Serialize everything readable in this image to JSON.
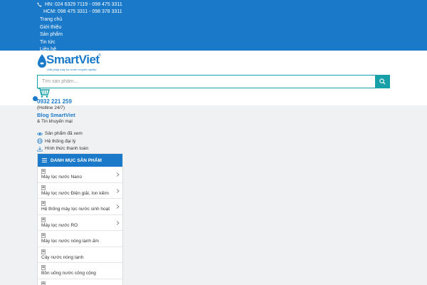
{
  "topbar": {
    "hn_label": "HN: 024 6329 7119 - 098 475 3311",
    "hcm_label": "HCM: 098 475 3311 - 098 378 3311",
    "nav": [
      "Trang chủ",
      "Giới thiệu",
      "Sản phẩm",
      "Tin tức",
      "Liên hệ"
    ],
    "bg_color": "#1a7ac9"
  },
  "header": {
    "logo_text": "SmartViet",
    "logo_tagline": "Giải pháp máy lọc nước chuyên nghiệp",
    "search_placeholder": "Tìm sản phẩm...",
    "hotline_number": "0932 221 259",
    "hotline_note": "(Hotline 24/7)",
    "blog_label": "Blog SmartViet",
    "blog_sub": "& Tin khuyến mại",
    "accent_color": "#17a0a8"
  },
  "quick_links": [
    {
      "icon": "eye-icon",
      "label": "Sản phẩm đã xem"
    },
    {
      "icon": "globe-icon",
      "label": "Hệ thống đại lý"
    },
    {
      "icon": "download-icon",
      "label": "Hình thức thanh toán"
    }
  ],
  "category": {
    "title": "DANH MỤC SẢN PHẨM",
    "items": [
      {
        "label": "Máy lọc nước Nano",
        "has_sub": true
      },
      {
        "label": "Máy lọc nước Điện giải, Ion kiềm",
        "has_sub": true
      },
      {
        "label": "Hệ thống máy lọc nước sinh hoạt",
        "has_sub": true
      },
      {
        "label": "Máy lọc nước RO",
        "has_sub": true
      },
      {
        "label": "Máy lọc nước nóng lạnh ấm",
        "has_sub": false
      },
      {
        "label": "Cây nước nóng lạnh",
        "has_sub": false
      },
      {
        "label": "Bồn uống nước công cộng",
        "has_sub": false
      },
      {
        "label": "",
        "has_sub": false
      }
    ]
  }
}
